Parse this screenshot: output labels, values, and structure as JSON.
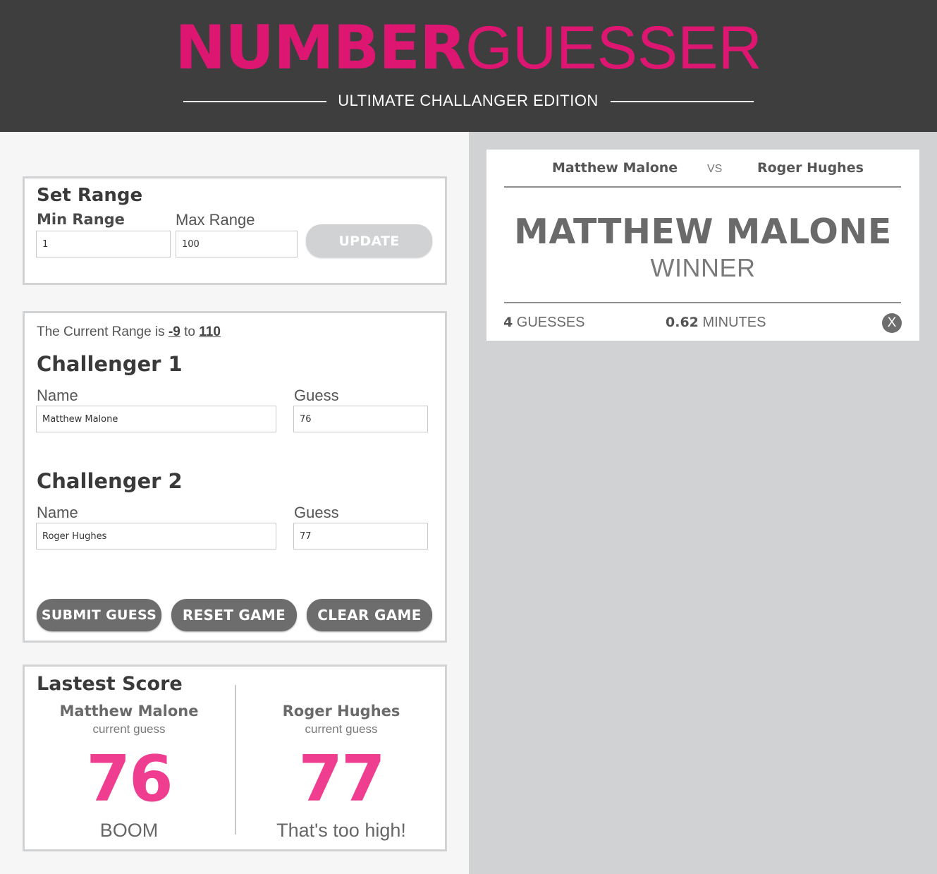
{
  "header": {
    "logo_bold": "NUMBER",
    "logo_light": "GUESSER",
    "subtitle": "ULTIMATE CHALLANGER EDITION"
  },
  "set_range": {
    "title": "Set Range",
    "min_label": "Min Range",
    "max_label": "Max Range",
    "min_value": "1",
    "max_value": "100",
    "update_label": "UPDATE"
  },
  "challengers": {
    "range_prefix": "The Current Range is",
    "range_min": "-9",
    "range_to": "to",
    "range_max": "110",
    "c1": {
      "title": "Challenger 1",
      "name_label": "Name",
      "guess_label": "Guess",
      "name_value": "Matthew Malone",
      "guess_value": "76"
    },
    "c2": {
      "title": "Challenger 2",
      "name_label": "Name",
      "guess_label": "Guess",
      "name_value": "Roger Hughes",
      "guess_value": "77"
    },
    "submit_label": "SUBMIT GUESS",
    "reset_label": "RESET GAME",
    "clear_label": "CLEAR GAME"
  },
  "latest_score": {
    "title": "Lastest Score",
    "p1": {
      "name": "Matthew Malone",
      "sub": "current guess",
      "guess": "76",
      "message": "BOOM"
    },
    "p2": {
      "name": "Roger Hughes",
      "sub": "current guess",
      "guess": "77",
      "message": "That's too high!"
    }
  },
  "winner_card": {
    "player1": "Matthew Malone",
    "vs": "VS",
    "player2": "Roger Hughes",
    "winner_name": "MATTHEW MALONE",
    "winner_label": "WINNER",
    "guesses_count": "4",
    "guesses_label": "GUESSES",
    "minutes_value": "0.62",
    "minutes_label": "MINUTES",
    "close_label": "X"
  },
  "colors": {
    "brand_pink": "#dd1672",
    "score_pink": "#ef3e8f",
    "header_bg": "#3e3e3e",
    "button_dark": "#6d6d6d",
    "panel_gray": "#d1d2d4"
  }
}
